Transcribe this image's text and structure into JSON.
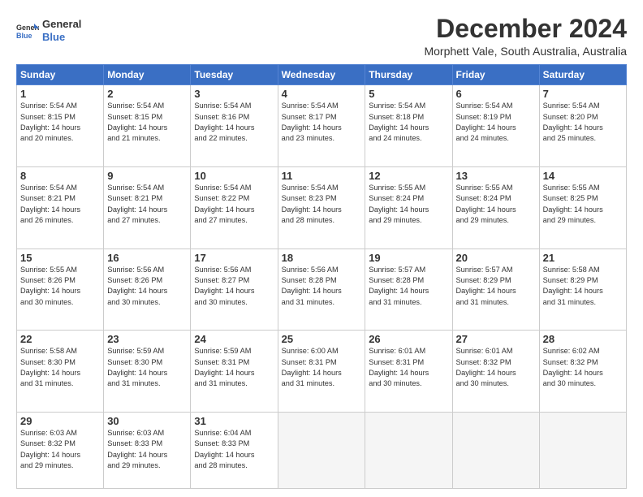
{
  "header": {
    "logo_line1": "General",
    "logo_line2": "Blue",
    "month": "December 2024",
    "location": "Morphett Vale, South Australia, Australia"
  },
  "days_of_week": [
    "Sunday",
    "Monday",
    "Tuesday",
    "Wednesday",
    "Thursday",
    "Friday",
    "Saturday"
  ],
  "weeks": [
    [
      {
        "day": "1",
        "info": "Sunrise: 5:54 AM\nSunset: 8:15 PM\nDaylight: 14 hours\nand 20 minutes."
      },
      {
        "day": "2",
        "info": "Sunrise: 5:54 AM\nSunset: 8:15 PM\nDaylight: 14 hours\nand 21 minutes."
      },
      {
        "day": "3",
        "info": "Sunrise: 5:54 AM\nSunset: 8:16 PM\nDaylight: 14 hours\nand 22 minutes."
      },
      {
        "day": "4",
        "info": "Sunrise: 5:54 AM\nSunset: 8:17 PM\nDaylight: 14 hours\nand 23 minutes."
      },
      {
        "day": "5",
        "info": "Sunrise: 5:54 AM\nSunset: 8:18 PM\nDaylight: 14 hours\nand 24 minutes."
      },
      {
        "day": "6",
        "info": "Sunrise: 5:54 AM\nSunset: 8:19 PM\nDaylight: 14 hours\nand 24 minutes."
      },
      {
        "day": "7",
        "info": "Sunrise: 5:54 AM\nSunset: 8:20 PM\nDaylight: 14 hours\nand 25 minutes."
      }
    ],
    [
      {
        "day": "8",
        "info": "Sunrise: 5:54 AM\nSunset: 8:21 PM\nDaylight: 14 hours\nand 26 minutes."
      },
      {
        "day": "9",
        "info": "Sunrise: 5:54 AM\nSunset: 8:21 PM\nDaylight: 14 hours\nand 27 minutes."
      },
      {
        "day": "10",
        "info": "Sunrise: 5:54 AM\nSunset: 8:22 PM\nDaylight: 14 hours\nand 27 minutes."
      },
      {
        "day": "11",
        "info": "Sunrise: 5:54 AM\nSunset: 8:23 PM\nDaylight: 14 hours\nand 28 minutes."
      },
      {
        "day": "12",
        "info": "Sunrise: 5:55 AM\nSunset: 8:24 PM\nDaylight: 14 hours\nand 29 minutes."
      },
      {
        "day": "13",
        "info": "Sunrise: 5:55 AM\nSunset: 8:24 PM\nDaylight: 14 hours\nand 29 minutes."
      },
      {
        "day": "14",
        "info": "Sunrise: 5:55 AM\nSunset: 8:25 PM\nDaylight: 14 hours\nand 29 minutes."
      }
    ],
    [
      {
        "day": "15",
        "info": "Sunrise: 5:55 AM\nSunset: 8:26 PM\nDaylight: 14 hours\nand 30 minutes."
      },
      {
        "day": "16",
        "info": "Sunrise: 5:56 AM\nSunset: 8:26 PM\nDaylight: 14 hours\nand 30 minutes."
      },
      {
        "day": "17",
        "info": "Sunrise: 5:56 AM\nSunset: 8:27 PM\nDaylight: 14 hours\nand 30 minutes."
      },
      {
        "day": "18",
        "info": "Sunrise: 5:56 AM\nSunset: 8:28 PM\nDaylight: 14 hours\nand 31 minutes."
      },
      {
        "day": "19",
        "info": "Sunrise: 5:57 AM\nSunset: 8:28 PM\nDaylight: 14 hours\nand 31 minutes."
      },
      {
        "day": "20",
        "info": "Sunrise: 5:57 AM\nSunset: 8:29 PM\nDaylight: 14 hours\nand 31 minutes."
      },
      {
        "day": "21",
        "info": "Sunrise: 5:58 AM\nSunset: 8:29 PM\nDaylight: 14 hours\nand 31 minutes."
      }
    ],
    [
      {
        "day": "22",
        "info": "Sunrise: 5:58 AM\nSunset: 8:30 PM\nDaylight: 14 hours\nand 31 minutes."
      },
      {
        "day": "23",
        "info": "Sunrise: 5:59 AM\nSunset: 8:30 PM\nDaylight: 14 hours\nand 31 minutes."
      },
      {
        "day": "24",
        "info": "Sunrise: 5:59 AM\nSunset: 8:31 PM\nDaylight: 14 hours\nand 31 minutes."
      },
      {
        "day": "25",
        "info": "Sunrise: 6:00 AM\nSunset: 8:31 PM\nDaylight: 14 hours\nand 31 minutes."
      },
      {
        "day": "26",
        "info": "Sunrise: 6:01 AM\nSunset: 8:31 PM\nDaylight: 14 hours\nand 30 minutes."
      },
      {
        "day": "27",
        "info": "Sunrise: 6:01 AM\nSunset: 8:32 PM\nDaylight: 14 hours\nand 30 minutes."
      },
      {
        "day": "28",
        "info": "Sunrise: 6:02 AM\nSunset: 8:32 PM\nDaylight: 14 hours\nand 30 minutes."
      }
    ],
    [
      {
        "day": "29",
        "info": "Sunrise: 6:03 AM\nSunset: 8:32 PM\nDaylight: 14 hours\nand 29 minutes."
      },
      {
        "day": "30",
        "info": "Sunrise: 6:03 AM\nSunset: 8:33 PM\nDaylight: 14 hours\nand 29 minutes."
      },
      {
        "day": "31",
        "info": "Sunrise: 6:04 AM\nSunset: 8:33 PM\nDaylight: 14 hours\nand 28 minutes."
      },
      {
        "day": "",
        "info": ""
      },
      {
        "day": "",
        "info": ""
      },
      {
        "day": "",
        "info": ""
      },
      {
        "day": "",
        "info": ""
      }
    ]
  ]
}
